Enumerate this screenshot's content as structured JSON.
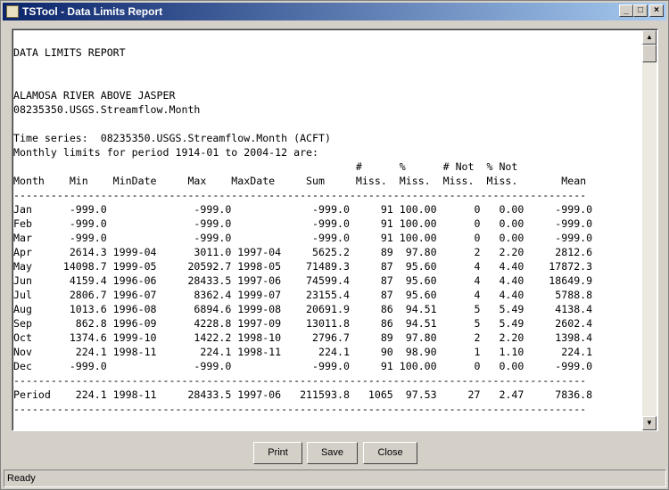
{
  "window": {
    "title": "TSTool - Data Limits Report",
    "minimize": "_",
    "maximize": "□",
    "close": "×"
  },
  "report": {
    "title": "DATA LIMITS REPORT",
    "location": "ALAMOSA RIVER ABOVE JASPER",
    "tsid": "08235350.USGS.Streamflow.Month",
    "timeseries": "Time series:  08235350.USGS.Streamflow.Month (ACFT)",
    "period": "Monthly limits for period 1914-01 to 2004-12 are:",
    "header1": "                                                       #      %      # Not  % Not",
    "header2": "Month    Min    MinDate     Max    MaxDate     Sum     Miss.  Miss.  Miss.  Miss.       Mean",
    "rows": [
      [
        "Jan",
        "-999.0",
        "",
        "-999.0",
        "",
        "-999.0",
        "91",
        "100.00",
        "0",
        "0.00",
        "-999.0"
      ],
      [
        "Feb",
        "-999.0",
        "",
        "-999.0",
        "",
        "-999.0",
        "91",
        "100.00",
        "0",
        "0.00",
        "-999.0"
      ],
      [
        "Mar",
        "-999.0",
        "",
        "-999.0",
        "",
        "-999.0",
        "91",
        "100.00",
        "0",
        "0.00",
        "-999.0"
      ],
      [
        "Apr",
        "2614.3",
        "1999-04",
        "3011.0",
        "1997-04",
        "5625.2",
        "89",
        "97.80",
        "2",
        "2.20",
        "2812.6"
      ],
      [
        "May",
        "14098.7",
        "1999-05",
        "20592.7",
        "1998-05",
        "71489.3",
        "87",
        "95.60",
        "4",
        "4.40",
        "17872.3"
      ],
      [
        "Jun",
        "4159.4",
        "1996-06",
        "28433.5",
        "1997-06",
        "74599.4",
        "87",
        "95.60",
        "4",
        "4.40",
        "18649.9"
      ],
      [
        "Jul",
        "2806.7",
        "1996-07",
        "8362.4",
        "1999-07",
        "23155.4",
        "87",
        "95.60",
        "4",
        "4.40",
        "5788.8"
      ],
      [
        "Aug",
        "1013.6",
        "1996-08",
        "6894.6",
        "1999-08",
        "20691.9",
        "86",
        "94.51",
        "5",
        "5.49",
        "4138.4"
      ],
      [
        "Sep",
        "862.8",
        "1996-09",
        "4228.8",
        "1997-09",
        "13011.8",
        "86",
        "94.51",
        "5",
        "5.49",
        "2602.4"
      ],
      [
        "Oct",
        "1374.6",
        "1999-10",
        "1422.2",
        "1998-10",
        "2796.7",
        "89",
        "97.80",
        "2",
        "2.20",
        "1398.4"
      ],
      [
        "Nov",
        "224.1",
        "1998-11",
        "224.1",
        "1998-11",
        "224.1",
        "90",
        "98.90",
        "1",
        "1.10",
        "224.1"
      ],
      [
        "Dec",
        "-999.0",
        "",
        "-999.0",
        "",
        "-999.0",
        "91",
        "100.00",
        "0",
        "0.00",
        "-999.0"
      ]
    ],
    "total": [
      "Period",
      "224.1",
      "1998-11",
      "28433.5",
      "1997-06",
      "211593.8",
      "1065",
      "97.53",
      "27",
      "2.47",
      "7836.8"
    ]
  },
  "buttons": {
    "print": "Print",
    "save": "Save",
    "close": "Close"
  },
  "status": "Ready"
}
